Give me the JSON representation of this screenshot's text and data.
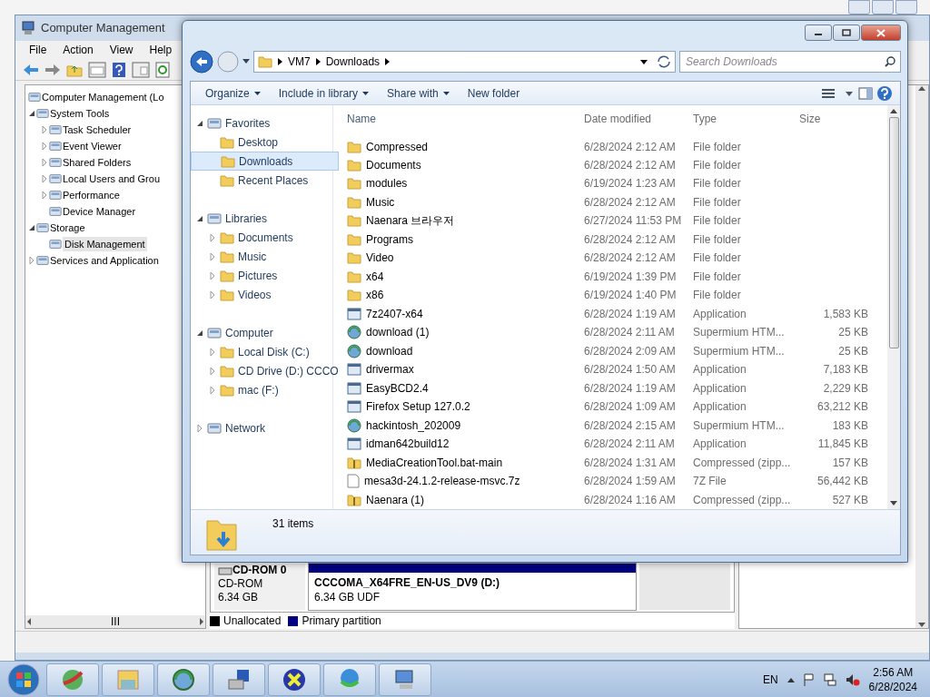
{
  "computer_management": {
    "title": "Computer Management",
    "menu": [
      "File",
      "Action",
      "View",
      "Help"
    ],
    "tree": [
      {
        "label": "Computer Management (Lo",
        "selected": false,
        "children": [
          {
            "label": "System Tools",
            "kind": "branch",
            "expanded": true,
            "selected": false,
            "children": [
              {
                "label": "Task Scheduler",
                "kind": "branch",
                "expanded": false,
                "selected": false
              },
              {
                "label": "Event Viewer",
                "kind": "branch",
                "expanded": false,
                "selected": false
              },
              {
                "label": "Shared Folders",
                "kind": "branch",
                "expanded": false,
                "selected": false
              },
              {
                "label": "Local Users and Grou",
                "kind": "branch",
                "expanded": false,
                "selected": false
              },
              {
                "label": "Performance",
                "kind": "branch",
                "expanded": false,
                "selected": false
              },
              {
                "label": "Device Manager",
                "kind": "leaf",
                "selected": false
              }
            ]
          },
          {
            "label": "Storage",
            "kind": "branch",
            "expanded": true,
            "selected": false,
            "children": [
              {
                "label": "Disk Management",
                "kind": "leaf",
                "selected": true
              }
            ]
          },
          {
            "label": "Services and Application",
            "kind": "branch",
            "expanded": false,
            "selected": false
          }
        ]
      }
    ],
    "disk": {
      "name": "CD-ROM 0",
      "type": "CD-ROM",
      "size": "6.34 GB",
      "volume_name": "CCCOMA_X64FRE_EN-US_DV9  (D:)",
      "volume_detail": "6.34 GB UDF"
    },
    "legend": [
      {
        "label": "Unallocated",
        "color": "#000000"
      },
      {
        "label": "Primary partition",
        "color": "#000080"
      }
    ],
    "scrollbar_thumb": "III"
  },
  "explorer": {
    "address": [
      "VM7",
      "Downloads"
    ],
    "search": {
      "placeholder": "Search Downloads"
    },
    "commands": [
      {
        "label": "Organize",
        "dropdown": true
      },
      {
        "label": "Include in library",
        "dropdown": true
      },
      {
        "label": "Share with",
        "dropdown": true
      },
      {
        "label": "New folder",
        "dropdown": false
      }
    ],
    "nav": [
      {
        "label": "Favorites",
        "kind": "branch",
        "expanded": true,
        "selected": false,
        "children": [
          {
            "label": "Desktop",
            "kind": "leaf",
            "selected": false
          },
          {
            "label": "Downloads",
            "kind": "leaf",
            "selected": true
          },
          {
            "label": "Recent Places",
            "kind": "leaf",
            "selected": false
          }
        ]
      },
      {
        "label": "Libraries",
        "kind": "branch",
        "expanded": true,
        "selected": false,
        "children": [
          {
            "label": "Documents",
            "kind": "branch",
            "expanded": false,
            "selected": false
          },
          {
            "label": "Music",
            "kind": "branch",
            "expanded": false,
            "selected": false
          },
          {
            "label": "Pictures",
            "kind": "branch",
            "expanded": false,
            "selected": false
          },
          {
            "label": "Videos",
            "kind": "branch",
            "expanded": false,
            "selected": false
          }
        ]
      },
      {
        "label": "Computer",
        "kind": "branch",
        "expanded": true,
        "selected": false,
        "children": [
          {
            "label": "Local Disk (C:)",
            "kind": "branch",
            "expanded": false,
            "selected": false
          },
          {
            "label": "CD Drive (D:) CCCO",
            "kind": "branch",
            "expanded": false,
            "selected": false
          },
          {
            "label": "mac (F:)",
            "kind": "branch",
            "expanded": false,
            "selected": false
          }
        ]
      },
      {
        "label": "Network",
        "kind": "branch",
        "expanded": false,
        "selected": false
      }
    ],
    "columns": [
      "Name",
      "Date modified",
      "Type",
      "Size"
    ],
    "rows": [
      {
        "kind": "folder",
        "name": "Compressed",
        "date": "6/28/2024 2:12 AM",
        "type": "File folder",
        "size": ""
      },
      {
        "kind": "folder",
        "name": "Documents",
        "date": "6/28/2024 2:12 AM",
        "type": "File folder",
        "size": ""
      },
      {
        "kind": "folder",
        "name": "modules",
        "date": "6/19/2024 1:23 AM",
        "type": "File folder",
        "size": ""
      },
      {
        "kind": "folder",
        "name": "Music",
        "date": "6/28/2024 2:12 AM",
        "type": "File folder",
        "size": ""
      },
      {
        "kind": "folder",
        "name": "Naenara 브라우저",
        "date": "6/27/2024 11:53 PM",
        "type": "File folder",
        "size": ""
      },
      {
        "kind": "folder",
        "name": "Programs",
        "date": "6/28/2024 2:12 AM",
        "type": "File folder",
        "size": ""
      },
      {
        "kind": "folder",
        "name": "Video",
        "date": "6/28/2024 2:12 AM",
        "type": "File folder",
        "size": ""
      },
      {
        "kind": "folder",
        "name": "x64",
        "date": "6/19/2024 1:39 PM",
        "type": "File folder",
        "size": ""
      },
      {
        "kind": "folder",
        "name": "x86",
        "date": "6/19/2024 1:40 PM",
        "type": "File folder",
        "size": ""
      },
      {
        "kind": "application",
        "name": "7z2407-x64",
        "date": "6/28/2024 1:19 AM",
        "type": "Application",
        "size": "1,583 KB"
      },
      {
        "kind": "html",
        "name": "download (1)",
        "date": "6/28/2024 2:11 AM",
        "type": "Supermium HTM...",
        "size": "25 KB"
      },
      {
        "kind": "html",
        "name": "download",
        "date": "6/28/2024 2:09 AM",
        "type": "Supermium HTM...",
        "size": "25 KB"
      },
      {
        "kind": "application",
        "name": "drivermax",
        "date": "6/28/2024 1:50 AM",
        "type": "Application",
        "size": "7,183 KB"
      },
      {
        "kind": "application",
        "name": "EasyBCD2.4",
        "date": "6/28/2024 1:19 AM",
        "type": "Application",
        "size": "2,229 KB"
      },
      {
        "kind": "application",
        "name": "Firefox Setup 127.0.2",
        "date": "6/28/2024 1:09 AM",
        "type": "Application",
        "size": "63,212 KB"
      },
      {
        "kind": "html",
        "name": "hackintosh_202009",
        "date": "6/28/2024 2:15 AM",
        "type": "Supermium HTM...",
        "size": "183 KB"
      },
      {
        "kind": "application",
        "name": "idman642build12",
        "date": "6/28/2024 2:11 AM",
        "type": "Application",
        "size": "11,845 KB"
      },
      {
        "kind": "zip",
        "name": "MediaCreationTool.bat-main",
        "date": "6/28/2024 1:31 AM",
        "type": "Compressed (zipp...",
        "size": "157 KB"
      },
      {
        "kind": "file",
        "name": "mesa3d-24.1.2-release-msvc.7z",
        "date": "6/28/2024 1:59 AM",
        "type": "7Z File",
        "size": "56,442 KB"
      },
      {
        "kind": "zip",
        "name": "Naenara (1)",
        "date": "6/28/2024 1:16 AM",
        "type": "Compressed (zipp...",
        "size": "527 KB"
      }
    ],
    "status": "31 items"
  },
  "taskbar": {
    "language": "EN",
    "time": "2:56 AM",
    "date": "6/28/2024"
  }
}
